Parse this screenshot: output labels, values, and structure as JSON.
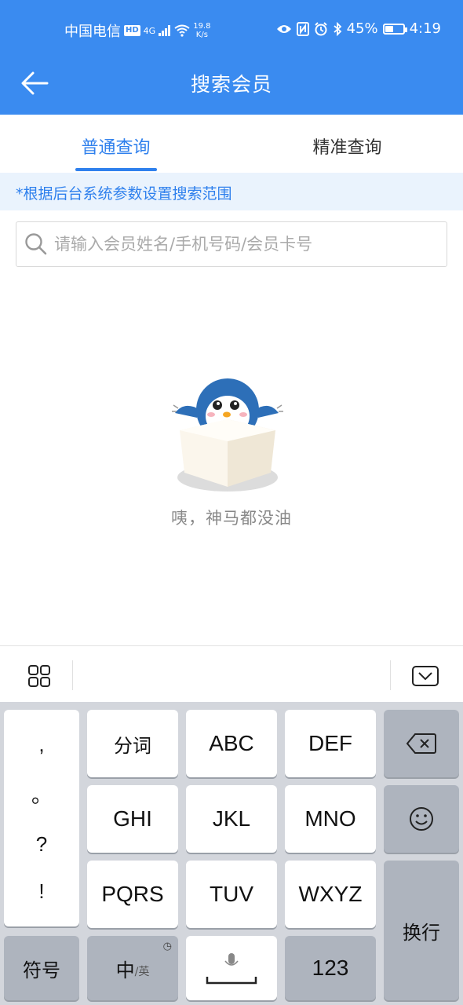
{
  "status_bar": {
    "carrier": "中国电信",
    "hd": "HD",
    "network": "4G",
    "speed_value": "19.8",
    "speed_unit": "K/s",
    "battery": "45%",
    "battery_level": 0.45,
    "time": "4:19"
  },
  "app_bar": {
    "title": "搜索会员"
  },
  "tabs": [
    {
      "label": "普通查询",
      "active": true
    },
    {
      "label": "精准查询",
      "active": false
    }
  ],
  "hint": "*根据后台系统参数设置搜索范围",
  "search": {
    "placeholder": "请输入会员姓名/手机号码/会员卡号",
    "value": ""
  },
  "empty_state": {
    "message": "咦，神马都没油"
  },
  "keyboard": {
    "punctuation": [
      ",",
      "。",
      "?",
      "!"
    ],
    "rows": [
      [
        "分词",
        "ABC",
        "DEF"
      ],
      [
        "GHI",
        "JKL",
        "MNO"
      ],
      [
        "PQRS",
        "TUV",
        "WXYZ"
      ]
    ],
    "symbols_label": "符号",
    "lang_main": "中",
    "lang_sub": "/英",
    "numbers_label": "123",
    "enter_label": "换行"
  },
  "colors": {
    "primary": "#3a8bf0",
    "accent_text": "#2f80ed",
    "hint_bg": "#eaf3fd"
  }
}
